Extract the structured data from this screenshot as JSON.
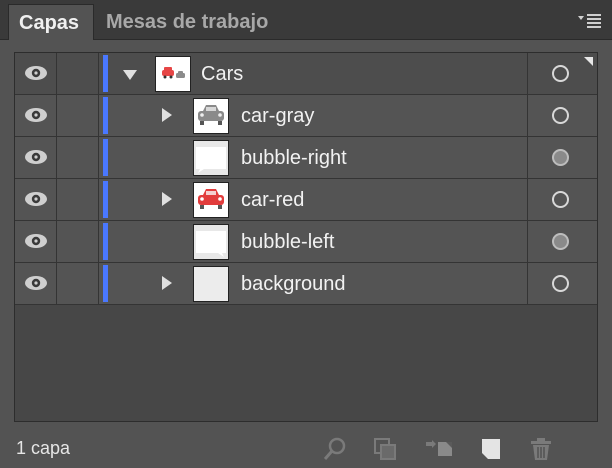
{
  "panel": {
    "tabs": [
      {
        "label": "Capas",
        "active": true
      },
      {
        "label": "Mesas de trabajo",
        "active": false
      }
    ],
    "accent_color": "#4a78ff"
  },
  "layers": [
    {
      "name": "Cars",
      "expanded": true,
      "visible": true,
      "thumbnail": "cars-group-icon",
      "target": "empty"
    },
    {
      "name": "car-gray",
      "expanded": false,
      "visible": true,
      "thumbnail": "car-gray-icon",
      "target": "empty"
    },
    {
      "name": "bubble-right",
      "expanded": null,
      "visible": true,
      "thumbnail": "bubble-icon",
      "target": "filled"
    },
    {
      "name": "car-red",
      "expanded": false,
      "visible": true,
      "thumbnail": "car-red-icon",
      "target": "empty"
    },
    {
      "name": "bubble-left",
      "expanded": null,
      "visible": true,
      "thumbnail": "bubble-icon",
      "target": "filled"
    },
    {
      "name": "background",
      "expanded": false,
      "visible": true,
      "thumbnail": "background-icon",
      "target": "empty"
    }
  ],
  "footer": {
    "count": "1 capa",
    "buttons": [
      "locate-object-icon",
      "make-clipping-mask-icon",
      "create-sublayer-icon",
      "create-new-layer-icon",
      "delete-icon"
    ]
  }
}
